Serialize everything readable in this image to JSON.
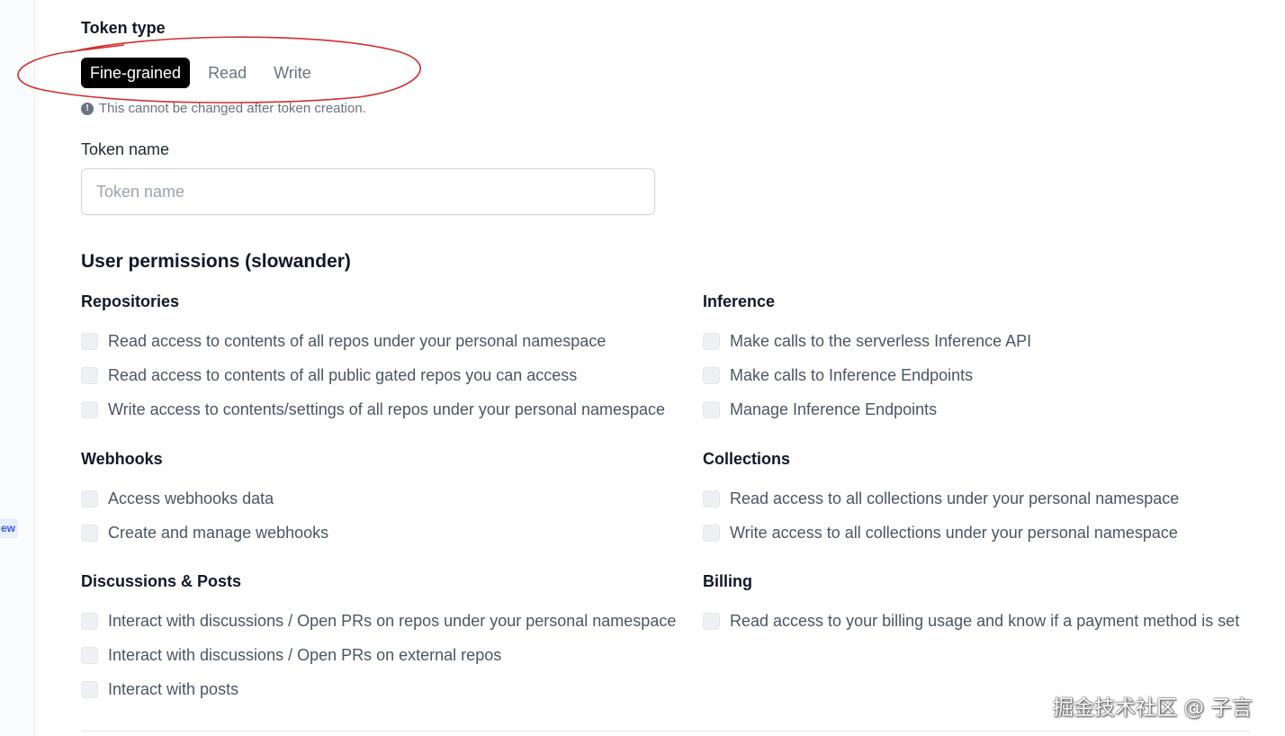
{
  "sidebar": {
    "badge_text": "ew"
  },
  "token_type": {
    "label": "Token type",
    "options": [
      "Fine-grained",
      "Read",
      "Write"
    ],
    "selected": "Fine-grained",
    "hint": "This cannot be changed after token creation.",
    "hint_icon": "info-icon",
    "annotation_color": "#d32f2f"
  },
  "token_name": {
    "label": "Token name",
    "placeholder": "Token name",
    "value": ""
  },
  "permissions": {
    "title": "User permissions (slowander)",
    "groups": {
      "repositories": {
        "title": "Repositories",
        "items": [
          "Read access to contents of all repos under your personal namespace",
          "Read access to contents of all public gated repos you can access",
          "Write access to contents/settings of all repos under your personal namespace"
        ]
      },
      "webhooks": {
        "title": "Webhooks",
        "items": [
          "Access webhooks data",
          "Create and manage webhooks"
        ]
      },
      "discussions": {
        "title": "Discussions & Posts",
        "items": [
          "Interact with discussions / Open PRs on repos under your personal namespace",
          "Interact with discussions / Open PRs on external repos",
          "Interact with posts"
        ]
      },
      "inference": {
        "title": "Inference",
        "items": [
          "Make calls to the serverless Inference API",
          "Make calls to Inference Endpoints",
          "Manage Inference Endpoints"
        ]
      },
      "collections": {
        "title": "Collections",
        "items": [
          "Read access to all collections under your personal namespace",
          "Write access to all collections under your personal namespace"
        ]
      },
      "billing": {
        "title": "Billing",
        "items": [
          "Read access to your billing usage and know if a payment method is set"
        ]
      }
    }
  },
  "watermark": "掘金技术社区 @ 子言"
}
